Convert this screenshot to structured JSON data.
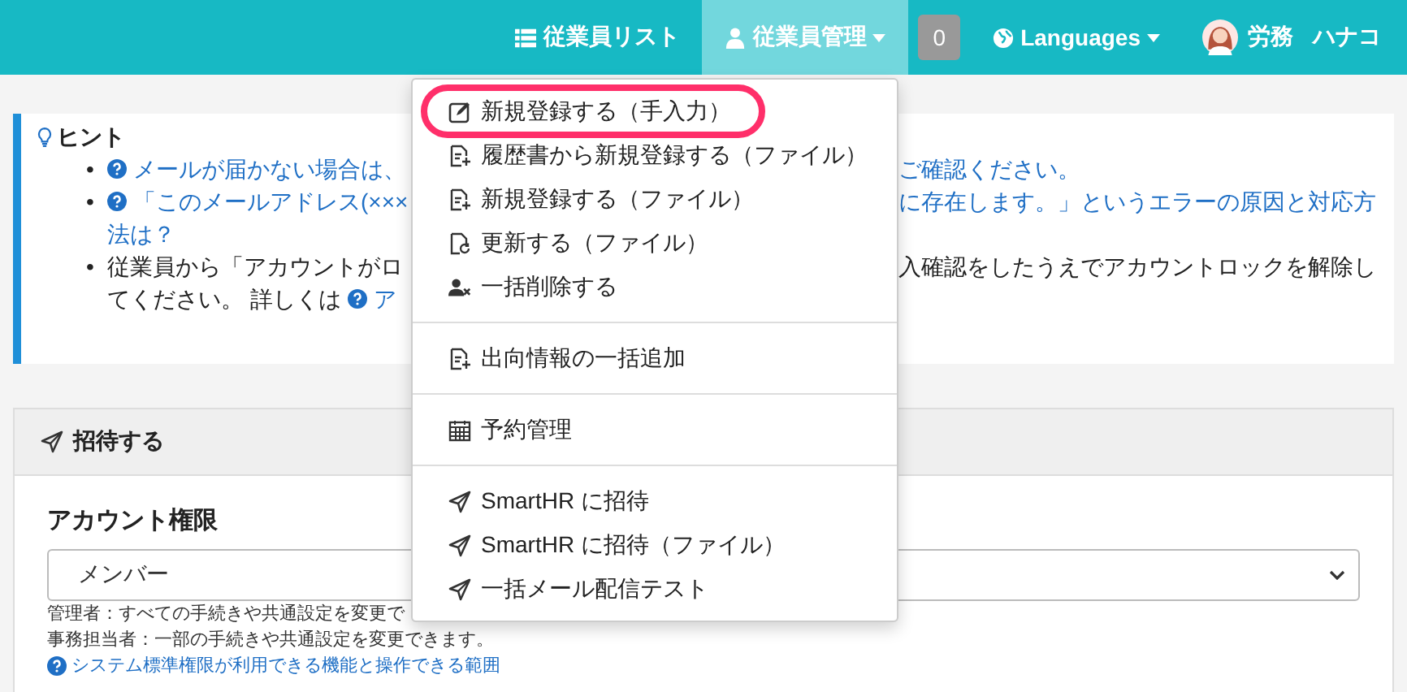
{
  "navbar": {
    "items": [
      {
        "label": "従業員リスト",
        "kind": "list",
        "selected": false,
        "caret": false
      },
      {
        "label": "従業員管理",
        "kind": "user",
        "selected": true,
        "caret": true
      }
    ],
    "badge": "0",
    "languages": "Languages",
    "user": {
      "surname": "労務",
      "given_name": "ハナコ"
    }
  },
  "dropdown": {
    "groups": [
      [
        {
          "label": "新規登録する（手入力）",
          "kind": "edit",
          "highlighted": true
        },
        {
          "label": "履歴書から新規登録する（ファイル）",
          "kind": "file",
          "highlighted": false
        },
        {
          "label": "新規登録する（ファイル）",
          "kind": "file",
          "highlighted": false
        },
        {
          "label": "更新する（ファイル）",
          "kind": "update",
          "highlighted": false
        },
        {
          "label": "一括削除する",
          "kind": "delete",
          "highlighted": false
        }
      ],
      [
        {
          "label": "出向情報の一括追加",
          "kind": "file",
          "highlighted": false
        }
      ],
      [
        {
          "label": "予約管理",
          "kind": "schedule",
          "highlighted": false
        }
      ],
      [
        {
          "label": "SmartHR に招待",
          "kind": "invite",
          "highlighted": false
        },
        {
          "label": "SmartHR に招待（ファイル）",
          "kind": "invite",
          "highlighted": false
        },
        {
          "label": "一括メール配信テスト",
          "kind": "invite",
          "highlighted": false
        }
      ]
    ]
  },
  "hint": {
    "title": "ヒント",
    "items": [
      {
        "kind": "link",
        "marker": "•",
        "lines": [
          {
            "left": "メールが届かない場合は、",
            "right": "ご確認ください。"
          }
        ]
      },
      {
        "kind": "link",
        "marker": "•",
        "lines": [
          {
            "left": "「このメールアドレス(×××",
            "right": "に存在します。」というエラーの原因と対応方"
          },
          {
            "left": "法は？"
          }
        ]
      },
      {
        "kind": "text",
        "marker": "•",
        "lines": [
          {
            "left": "従業員から「アカウントがロ",
            "right": "入確認をしたうえでアカウントロックを解除し"
          },
          {
            "left": "てください。 詳しくは",
            "link": "ア"
          }
        ]
      }
    ]
  },
  "invite_panel": {
    "title": "招待する",
    "field_label": "アカウント権限",
    "select_value": "メンバー",
    "help": [
      "管理者：すべての手続きや共通設定を変更で",
      "事務担当者：一部の手続きや共通設定を変更できます。"
    ],
    "help_link": "システム標準権限が利用できる機能と操作できる範囲"
  }
}
